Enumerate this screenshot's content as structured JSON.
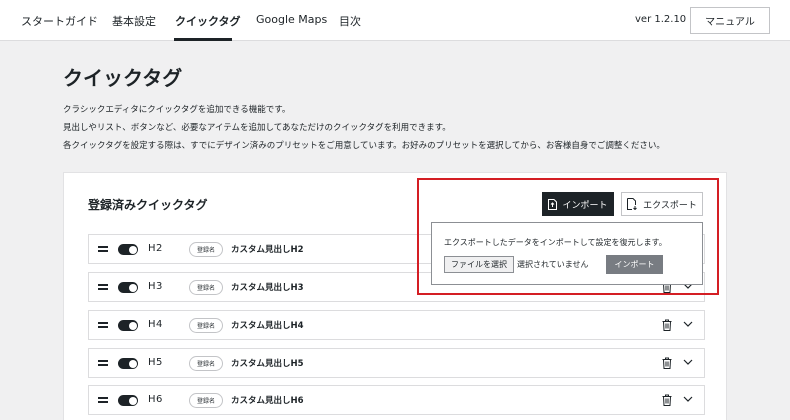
{
  "nav": {
    "items": [
      {
        "label": "スタートガイド"
      },
      {
        "label": "基本設定"
      },
      {
        "label": "クイックタグ"
      },
      {
        "label": "Google Maps"
      },
      {
        "label": "目次"
      }
    ],
    "version": "ver 1.2.10",
    "manual_label": "マニュアル"
  },
  "page": {
    "title": "クイックタグ",
    "desc1": "クラシックエディタにクイックタグを追加できる機能です。",
    "desc2": "見出しやリスト、ボタンなど、必要なアイテムを追加してあなただけのクイックタグを利用できます。",
    "desc3": "各クイックタグを設定する際は、すでにデザイン済みのプリセットをご用意しています。お好みのプリセットを選択してから、お客様自身でご調整ください。"
  },
  "card": {
    "title": "登録済みクイックタグ",
    "import_label": "インポート",
    "export_label": "エクスポート",
    "popover": {
      "text": "エクスポートしたデータをインポートして設定を復元します。",
      "file_button": "ファイルを選択",
      "file_status": "選択されていません",
      "import_label": "インポート"
    },
    "rows": [
      {
        "tag": "H2",
        "badge": "登録名",
        "label": "カスタム見出しH2",
        "enabled": true
      },
      {
        "tag": "H3",
        "badge": "登録名",
        "label": "カスタム見出しH3",
        "enabled": true
      },
      {
        "tag": "H4",
        "badge": "登録名",
        "label": "カスタム見出しH4",
        "enabled": true
      },
      {
        "tag": "H5",
        "badge": "登録名",
        "label": "カスタム見出しH5",
        "enabled": true
      },
      {
        "tag": "H6",
        "badge": "登録名",
        "label": "カスタム見出しH6",
        "enabled": true
      }
    ]
  },
  "colors": {
    "accent": "#1d2327",
    "highlight": "#d41e24",
    "background": "#f0f0f1"
  },
  "icons": {
    "drag": "drag-handle-icon",
    "toggle": "toggle-switch",
    "trash": "trash-icon",
    "chevron": "chevron-down-icon",
    "import": "file-import-icon",
    "export": "file-export-icon"
  }
}
